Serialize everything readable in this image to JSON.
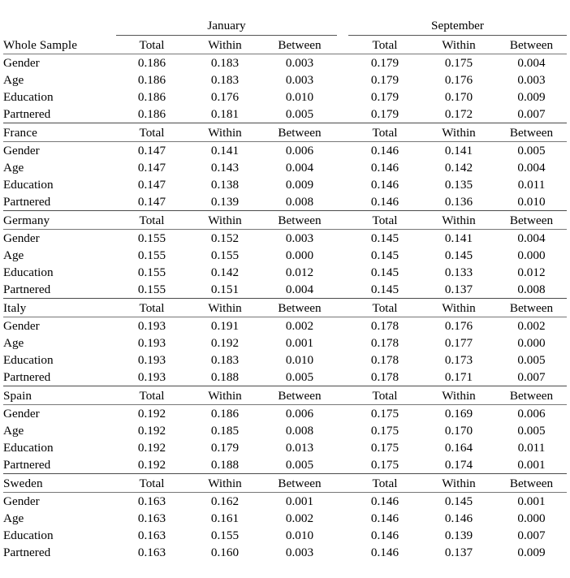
{
  "table": {
    "periods": [
      "January",
      "September"
    ],
    "column_headers": [
      "Total",
      "Within",
      "Between"
    ],
    "row_labels": [
      "Gender",
      "Age",
      "Education",
      "Partnered"
    ],
    "groups": [
      {
        "name": "Whole Sample",
        "rows": [
          {
            "label": "Gender",
            "jan": [
              "0.186",
              "0.183",
              "0.003"
            ],
            "sep": [
              "0.179",
              "0.175",
              "0.004"
            ]
          },
          {
            "label": "Age",
            "jan": [
              "0.186",
              "0.183",
              "0.003"
            ],
            "sep": [
              "0.179",
              "0.176",
              "0.003"
            ]
          },
          {
            "label": "Education",
            "jan": [
              "0.186",
              "0.176",
              "0.010"
            ],
            "sep": [
              "0.179",
              "0.170",
              "0.009"
            ]
          },
          {
            "label": "Partnered",
            "jan": [
              "0.186",
              "0.181",
              "0.005"
            ],
            "sep": [
              "0.179",
              "0.172",
              "0.007"
            ]
          }
        ]
      },
      {
        "name": "France",
        "rows": [
          {
            "label": "Gender",
            "jan": [
              "0.147",
              "0.141",
              "0.006"
            ],
            "sep": [
              "0.146",
              "0.141",
              "0.005"
            ]
          },
          {
            "label": "Age",
            "jan": [
              "0.147",
              "0.143",
              "0.004"
            ],
            "sep": [
              "0.146",
              "0.142",
              "0.004"
            ]
          },
          {
            "label": "Education",
            "jan": [
              "0.147",
              "0.138",
              "0.009"
            ],
            "sep": [
              "0.146",
              "0.135",
              "0.011"
            ]
          },
          {
            "label": "Partnered",
            "jan": [
              "0.147",
              "0.139",
              "0.008"
            ],
            "sep": [
              "0.146",
              "0.136",
              "0.010"
            ]
          }
        ]
      },
      {
        "name": "Germany",
        "rows": [
          {
            "label": "Gender",
            "jan": [
              "0.155",
              "0.152",
              "0.003"
            ],
            "sep": [
              "0.145",
              "0.141",
              "0.004"
            ]
          },
          {
            "label": "Age",
            "jan": [
              "0.155",
              "0.155",
              "0.000"
            ],
            "sep": [
              "0.145",
              "0.145",
              "0.000"
            ]
          },
          {
            "label": "Education",
            "jan": [
              "0.155",
              "0.142",
              "0.012"
            ],
            "sep": [
              "0.145",
              "0.133",
              "0.012"
            ]
          },
          {
            "label": "Partnered",
            "jan": [
              "0.155",
              "0.151",
              "0.004"
            ],
            "sep": [
              "0.145",
              "0.137",
              "0.008"
            ]
          }
        ]
      },
      {
        "name": "Italy",
        "rows": [
          {
            "label": "Gender",
            "jan": [
              "0.193",
              "0.191",
              "0.002"
            ],
            "sep": [
              "0.178",
              "0.176",
              "0.002"
            ]
          },
          {
            "label": "Age",
            "jan": [
              "0.193",
              "0.192",
              "0.001"
            ],
            "sep": [
              "0.178",
              "0.177",
              "0.000"
            ]
          },
          {
            "label": "Education",
            "jan": [
              "0.193",
              "0.183",
              "0.010"
            ],
            "sep": [
              "0.178",
              "0.173",
              "0.005"
            ]
          },
          {
            "label": "Partnered",
            "jan": [
              "0.193",
              "0.188",
              "0.005"
            ],
            "sep": [
              "0.178",
              "0.171",
              "0.007"
            ]
          }
        ]
      },
      {
        "name": "Spain",
        "rows": [
          {
            "label": "Gender",
            "jan": [
              "0.192",
              "0.186",
              "0.006"
            ],
            "sep": [
              "0.175",
              "0.169",
              "0.006"
            ]
          },
          {
            "label": "Age",
            "jan": [
              "0.192",
              "0.185",
              "0.008"
            ],
            "sep": [
              "0.175",
              "0.170",
              "0.005"
            ]
          },
          {
            "label": "Education",
            "jan": [
              "0.192",
              "0.179",
              "0.013"
            ],
            "sep": [
              "0.175",
              "0.164",
              "0.011"
            ]
          },
          {
            "label": "Partnered",
            "jan": [
              "0.192",
              "0.188",
              "0.005"
            ],
            "sep": [
              "0.175",
              "0.174",
              "0.001"
            ]
          }
        ]
      },
      {
        "name": "Sweden",
        "rows": [
          {
            "label": "Gender",
            "jan": [
              "0.163",
              "0.162",
              "0.001"
            ],
            "sep": [
              "0.146",
              "0.145",
              "0.001"
            ]
          },
          {
            "label": "Age",
            "jan": [
              "0.163",
              "0.161",
              "0.002"
            ],
            "sep": [
              "0.146",
              "0.146",
              "0.000"
            ]
          },
          {
            "label": "Education",
            "jan": [
              "0.163",
              "0.155",
              "0.010"
            ],
            "sep": [
              "0.146",
              "0.139",
              "0.007"
            ]
          },
          {
            "label": "Partnered",
            "jan": [
              "0.163",
              "0.160",
              "0.003"
            ],
            "sep": [
              "0.146",
              "0.137",
              "0.009"
            ]
          }
        ]
      }
    ]
  }
}
